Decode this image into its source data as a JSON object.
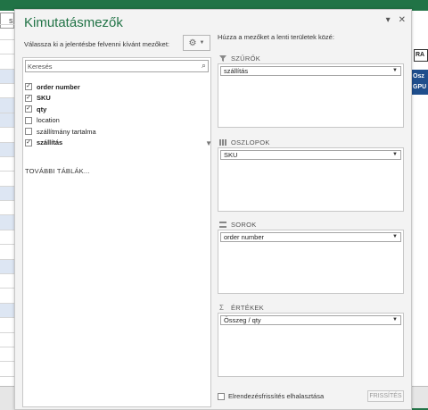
{
  "app": {
    "title": "Kimutatásmezők"
  },
  "background": {
    "cell_text": "s",
    "right_cells": [
      "RA",
      "Osz",
      "GPU"
    ]
  },
  "left_panel": {
    "instruction": "Válassza ki a jelentésbe felvenni kívánt mezőket:",
    "search_placeholder": "Keresés",
    "fields": [
      {
        "label": "order number",
        "checked": true,
        "bold": true
      },
      {
        "label": "SKU",
        "checked": true,
        "bold": true
      },
      {
        "label": "qty",
        "checked": true,
        "bold": true
      },
      {
        "label": "location",
        "checked": false,
        "bold": false
      },
      {
        "label": "szállítmány tartalma",
        "checked": false,
        "bold": false
      },
      {
        "label": "szállítás",
        "checked": true,
        "bold": true,
        "filtered": true
      }
    ],
    "more_tables": "TOVÁBBI TÁBLÁK..."
  },
  "right_panel": {
    "instruction": "Húzza a mezőket a lenti területek közé:",
    "areas": [
      {
        "name": "SZŰRŐK",
        "items": [
          "szállítás"
        ]
      },
      {
        "name": "OSZLOPOK",
        "items": [
          "SKU"
        ]
      },
      {
        "name": "SOROK",
        "items": [
          "order number"
        ]
      },
      {
        "name": "ÉRTÉKEK",
        "items": [
          "Összeg / qty"
        ]
      }
    ],
    "defer_label": "Elrendezésfrissítés elhalasztása",
    "refresh_label": "FRISSÍTÉS"
  },
  "colors": {
    "accent": "#217346",
    "header_blue": "#1f4e8c"
  }
}
